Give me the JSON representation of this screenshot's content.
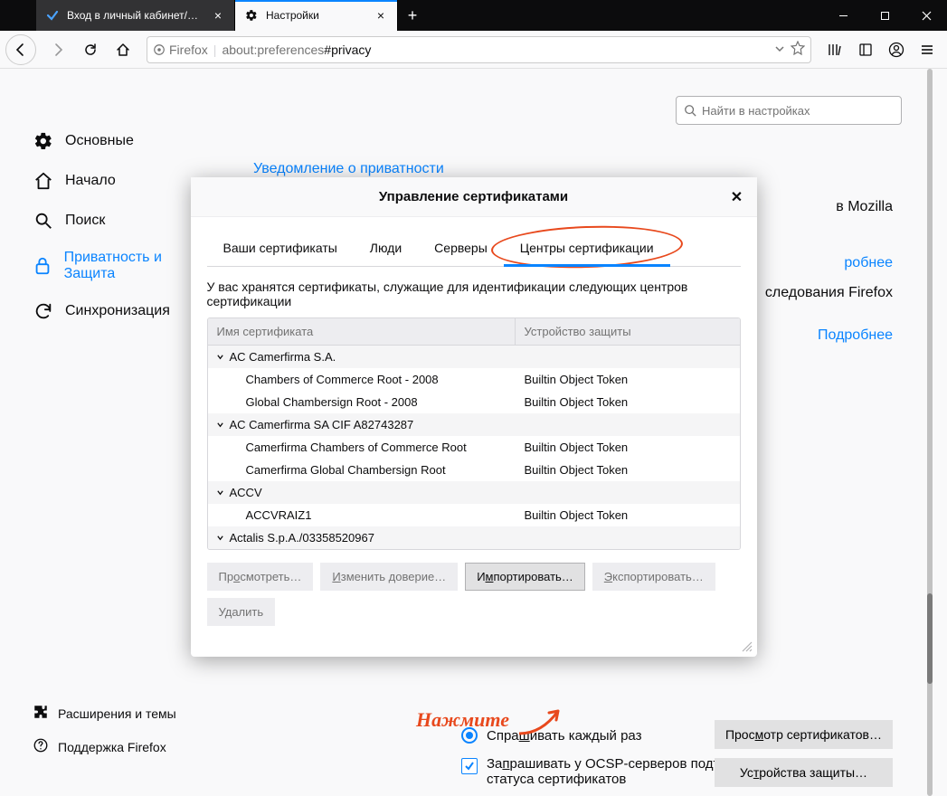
{
  "tabs": [
    {
      "label": "Вход в личный кабинет/СБИС",
      "active": false
    },
    {
      "label": "Настройки",
      "active": true
    }
  ],
  "toolbar": {
    "identity": "Firefox",
    "url_prefix": "about:preferences",
    "url_hash": "#privacy"
  },
  "search": {
    "placeholder": "Найти в настройках"
  },
  "sidebar": {
    "items": [
      {
        "label": "Основные"
      },
      {
        "label": "Начало"
      },
      {
        "label": "Поиск"
      },
      {
        "label": "Приватность и Защита"
      },
      {
        "label": "Синхронизация"
      }
    ],
    "extensions": "Расширения и темы",
    "support": "Поддержка Firefox"
  },
  "main": {
    "privacy_notice": "Уведомление о приватности",
    "moz_text": "в Mozilla",
    "more1": "робнее",
    "studies": "следования Firefox",
    "more2": "Подробнее",
    "radio_label": "Спрашивать каждый раз",
    "ocsp_label": "Запрашивать у OCSP-серверов подтверждение текущего статуса сертификатов",
    "btn_view_certs": "Просмотр сертификатов…",
    "btn_devices": "Устройства защиты…"
  },
  "modal": {
    "title": "Управление сертификатами",
    "tabs": [
      "Ваши сертификаты",
      "Люди",
      "Серверы",
      "Центры сертификации"
    ],
    "description": "У вас хранятся сертификаты, служащие для идентификации следующих центров сертификации",
    "col_name": "Имя сертификата",
    "col_device": "Устройство защиты",
    "groups": [
      {
        "name": "AC Camerfirma S.A.",
        "rows": [
          {
            "name": "Chambers of Commerce Root - 2008",
            "device": "Builtin Object Token"
          },
          {
            "name": "Global Chambersign Root - 2008",
            "device": "Builtin Object Token"
          }
        ]
      },
      {
        "name": "AC Camerfirma SA CIF A82743287",
        "rows": [
          {
            "name": "Camerfirma Chambers of Commerce Root",
            "device": "Builtin Object Token"
          },
          {
            "name": "Camerfirma Global Chambersign Root",
            "device": "Builtin Object Token"
          }
        ]
      },
      {
        "name": "ACCV",
        "rows": [
          {
            "name": "ACCVRAIZ1",
            "device": "Builtin Object Token"
          }
        ]
      },
      {
        "name": "Actalis S.p.A./03358520967",
        "rows": []
      }
    ],
    "buttons": {
      "view": "Просмотреть…",
      "trust": "Изменить доверие…",
      "import": "Импортировать…",
      "export": "Экспортировать…",
      "delete": "Удалить"
    }
  },
  "annotation": {
    "text": "Нажмите"
  }
}
